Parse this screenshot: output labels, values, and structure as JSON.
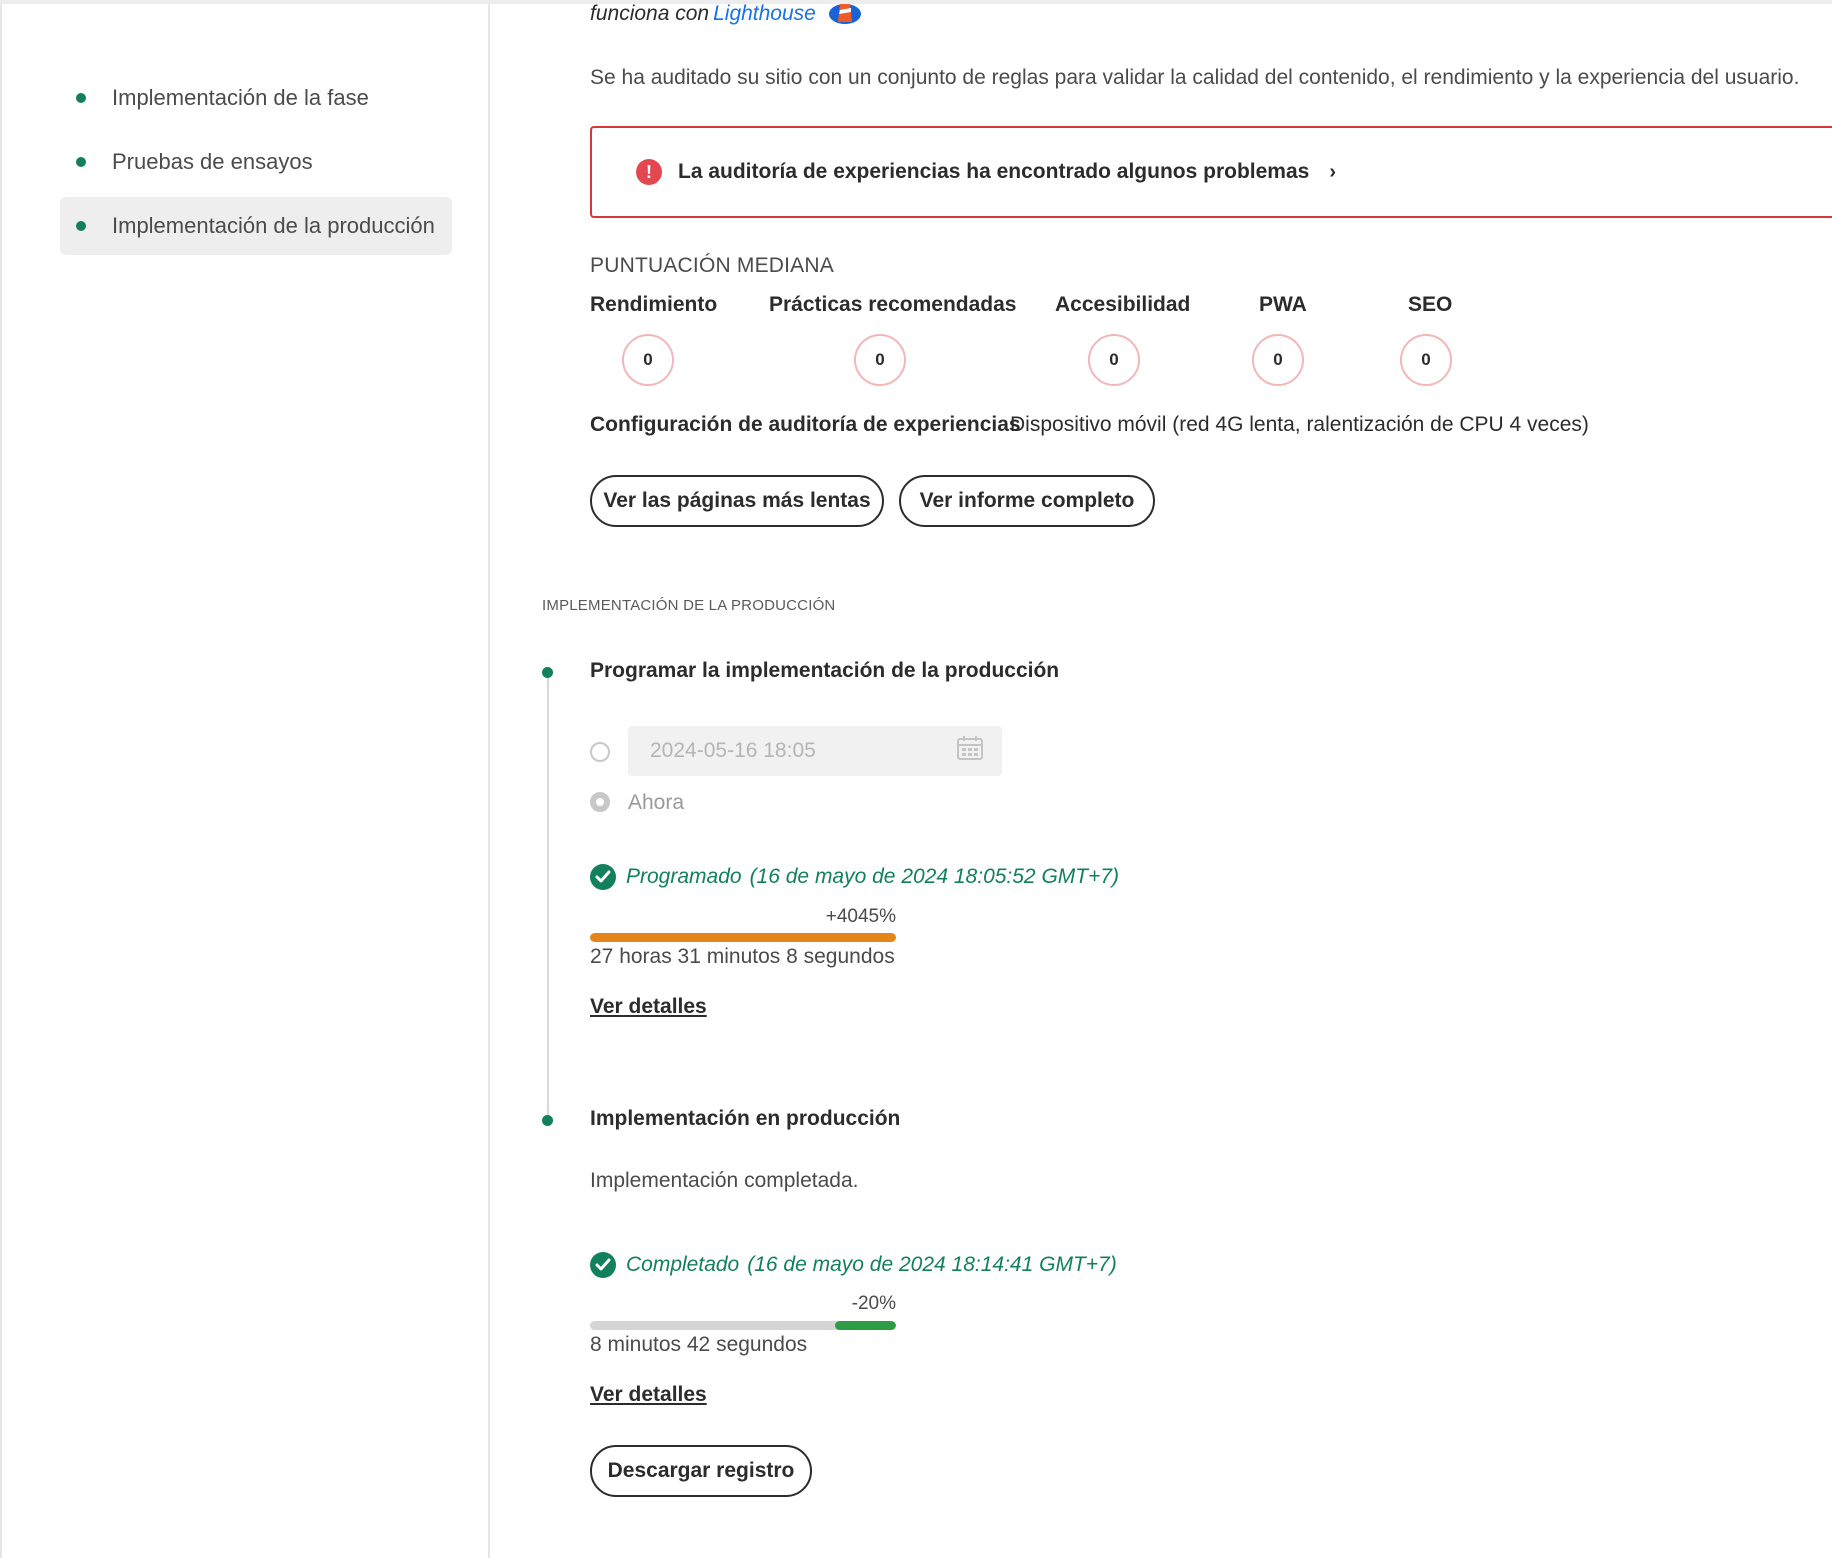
{
  "sidebar": {
    "items": [
      {
        "label": "Implementación de la fase"
      },
      {
        "label": "Pruebas de ensayos"
      },
      {
        "label": "Implementación de la producción"
      }
    ]
  },
  "header": {
    "powered_by": "funciona con",
    "powered_link": "Lighthouse",
    "intro": "Se ha auditado su sitio con un conjunto de reglas para validar la calidad del contenido, el rendimiento y la experiencia del usuario."
  },
  "alert": {
    "message": "La auditoría de experiencias ha encontrado algunos problemas",
    "chevron": "›"
  },
  "scores": {
    "title": "PUNTUACIÓN MEDIANA",
    "items": [
      {
        "label": "Rendimiento",
        "value": "0"
      },
      {
        "label": "Prácticas recomendadas",
        "value": "0"
      },
      {
        "label": "Accesibilidad",
        "value": "0"
      },
      {
        "label": "PWA",
        "value": "0"
      },
      {
        "label": "SEO",
        "value": "0"
      }
    ]
  },
  "config": {
    "label": "Configuración de auditoría de experiencias",
    "value": "Dispositivo móvil (red 4G lenta, ralentización de CPU 4 veces)"
  },
  "actions": {
    "slowest_pages": "Ver las páginas más lentas",
    "full_report": "Ver informe completo"
  },
  "production": {
    "section_label": "IMPLEMENTACIÓN DE LA PRODUCCIÓN",
    "schedule": {
      "title": "Programar la implementación de la producción",
      "date_value": "2024-05-16 18:05",
      "now_label": "Ahora",
      "status": "Programado",
      "status_date": "(16 de mayo de 2024 18:05:52 GMT+7)",
      "percent": "+4045%",
      "bar_fill_fraction": 1.0,
      "duration": "27 horas 31 minutos 8 segundos",
      "details_link": "Ver detalles"
    },
    "deploy": {
      "title": "Implementación en producción",
      "message": "Implementación completada.",
      "status": "Completado",
      "status_date": "(16 de mayo de 2024 18:14:41 GMT+7)",
      "percent": "-20%",
      "bar_fill_fraction": 0.2,
      "duration": "8 minutos 42 segundos",
      "details_link": "Ver detalles",
      "download_log": "Descargar registro"
    }
  },
  "colors": {
    "accent_green": "#12805c",
    "error_red": "#d7373f",
    "bar_orange": "#e68619",
    "bar_green": "#2d9d45",
    "link_blue": "#1473e6"
  }
}
